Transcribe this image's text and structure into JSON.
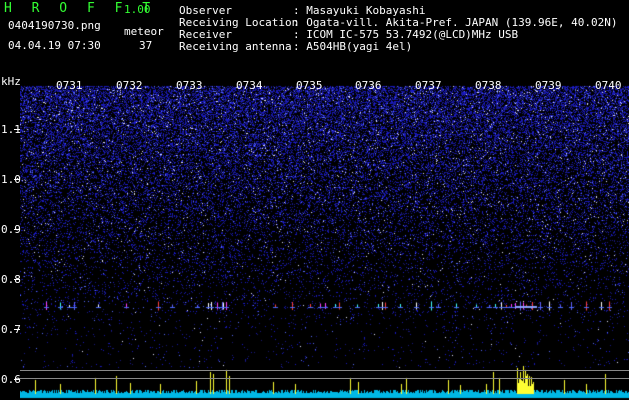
{
  "app": {
    "name": "H R O F F T",
    "version": "1.00",
    "filename": "0404190730.png",
    "datetime": "04.04.19 07:30",
    "meteor_label": "meteor",
    "meteor_count": "37"
  },
  "info": [
    {
      "key": "Observer",
      "value": ": Masayuki Kobayashi"
    },
    {
      "key": "Receiving Location",
      "value": ": Ogata-vill. Akita-Pref. JAPAN (139.96E, 40.02N)"
    },
    {
      "key": "Receiver",
      "value": ": ICOM IC-575 53.7492(@LCD)MHz USB"
    },
    {
      "key": "Receiving antenna",
      "value": ": A504HB(yagi 4el)"
    }
  ],
  "plot": {
    "y_unit": "kHz",
    "y_labels": [
      "1.1",
      "1.0",
      "0.9",
      "0.8",
      "0.7",
      "0.6"
    ],
    "time_labels": [
      "0731",
      "0732",
      "0733",
      "0734",
      "0735",
      "0736",
      "0737",
      "0738",
      "0739",
      "0740"
    ],
    "colors": {
      "background": "#000000",
      "noise": "#2828c8",
      "signal": "#ffff00",
      "baseline": "#00c8ff"
    }
  }
}
